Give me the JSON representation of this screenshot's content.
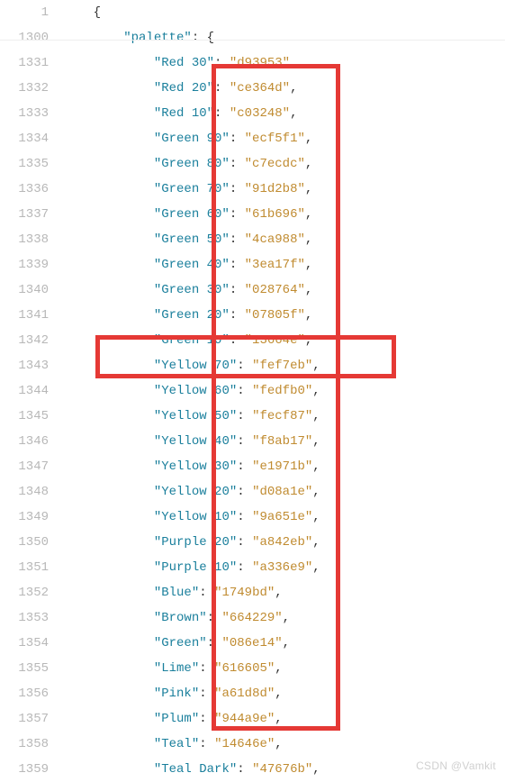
{
  "lines": [
    {
      "num": "1",
      "indent": "    ",
      "type": "open-brace",
      "text": "{"
    },
    {
      "num": "1300",
      "indent": "        ",
      "type": "key-open",
      "key": "palette",
      "after": ": {"
    },
    {
      "num": "1331",
      "indent": "            ",
      "type": "kv",
      "key": "Red 30",
      "val": "d93953"
    },
    {
      "num": "1332",
      "indent": "            ",
      "type": "kv",
      "key": "Red 20",
      "val": "ce364d"
    },
    {
      "num": "1333",
      "indent": "            ",
      "type": "kv",
      "key": "Red 10",
      "val": "c03248"
    },
    {
      "num": "1334",
      "indent": "            ",
      "type": "kv",
      "key": "Green 90",
      "val": "ecf5f1"
    },
    {
      "num": "1335",
      "indent": "            ",
      "type": "kv",
      "key": "Green 80",
      "val": "c7ecdc"
    },
    {
      "num": "1336",
      "indent": "            ",
      "type": "kv",
      "key": "Green 70",
      "val": "91d2b8"
    },
    {
      "num": "1337",
      "indent": "            ",
      "type": "kv",
      "key": "Green 60",
      "val": "61b696"
    },
    {
      "num": "1338",
      "indent": "            ",
      "type": "kv",
      "key": "Green 50",
      "val": "4ca988"
    },
    {
      "num": "1339",
      "indent": "            ",
      "type": "kv",
      "key": "Green 40",
      "val": "3ea17f"
    },
    {
      "num": "1340",
      "indent": "            ",
      "type": "kv",
      "key": "Green 30",
      "val": "028764"
    },
    {
      "num": "1341",
      "indent": "            ",
      "type": "kv",
      "key": "Green 20",
      "val": "07805f"
    },
    {
      "num": "1342",
      "indent": "            ",
      "type": "kv",
      "key": "Green 10",
      "val": "13664e"
    },
    {
      "num": "1343",
      "indent": "            ",
      "type": "kv",
      "key": "Yellow 70",
      "val": "fef7eb"
    },
    {
      "num": "1344",
      "indent": "            ",
      "type": "kv",
      "key": "Yellow 60",
      "val": "fedfb0"
    },
    {
      "num": "1345",
      "indent": "            ",
      "type": "kv",
      "key": "Yellow 50",
      "val": "fecf87"
    },
    {
      "num": "1346",
      "indent": "            ",
      "type": "kv",
      "key": "Yellow 40",
      "val": "f8ab17"
    },
    {
      "num": "1347",
      "indent": "            ",
      "type": "kv",
      "key": "Yellow 30",
      "val": "e1971b"
    },
    {
      "num": "1348",
      "indent": "            ",
      "type": "kv",
      "key": "Yellow 20",
      "val": "d08a1e"
    },
    {
      "num": "1349",
      "indent": "            ",
      "type": "kv",
      "key": "Yellow 10",
      "val": "9a651e"
    },
    {
      "num": "1350",
      "indent": "            ",
      "type": "kv",
      "key": "Purple 20",
      "val": "a842eb"
    },
    {
      "num": "1351",
      "indent": "            ",
      "type": "kv",
      "key": "Purple 10",
      "val": "a336e9"
    },
    {
      "num": "1352",
      "indent": "            ",
      "type": "kv",
      "key": "Blue",
      "val": "1749bd"
    },
    {
      "num": "1353",
      "indent": "            ",
      "type": "kv",
      "key": "Brown",
      "val": "664229"
    },
    {
      "num": "1354",
      "indent": "            ",
      "type": "kv",
      "key": "Green",
      "val": "086e14"
    },
    {
      "num": "1355",
      "indent": "            ",
      "type": "kv",
      "key": "Lime",
      "val": "616605"
    },
    {
      "num": "1356",
      "indent": "            ",
      "type": "kv",
      "key": "Pink",
      "val": "a61d8d"
    },
    {
      "num": "1357",
      "indent": "            ",
      "type": "kv",
      "key": "Plum",
      "val": "944a9e"
    },
    {
      "num": "1358",
      "indent": "            ",
      "type": "kv",
      "key": "Teal",
      "val": "14646e"
    },
    {
      "num": "1359",
      "indent": "            ",
      "type": "kv",
      "key": "Teal Dark",
      "val": "47676b"
    }
  ],
  "watermark": "CSDN @Vamkit"
}
